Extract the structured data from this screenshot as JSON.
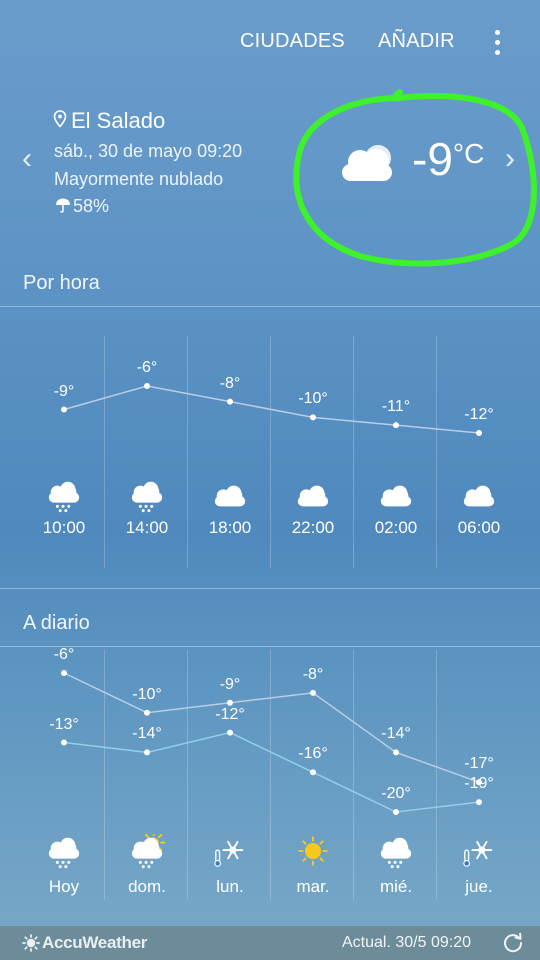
{
  "header": {
    "cities_label": "CIUDADES",
    "add_label": "AÑADIR"
  },
  "location": {
    "name": "El Salado",
    "datetime": "sáb., 30 de mayo 09:20",
    "condition": "Mayormente nublado",
    "precipitation": "58%"
  },
  "current": {
    "temperature": "-9",
    "unit": "°C",
    "icon": "cloud-icon"
  },
  "hourly": {
    "title": "Por hora",
    "items": [
      {
        "time": "10:00",
        "temp": "-9°",
        "value": -9,
        "icon": "cloud-snow-icon"
      },
      {
        "time": "14:00",
        "temp": "-6°",
        "value": -6,
        "icon": "cloud-snow-icon"
      },
      {
        "time": "18:00",
        "temp": "-8°",
        "value": -8,
        "icon": "cloud-icon"
      },
      {
        "time": "22:00",
        "temp": "-10°",
        "value": -10,
        "icon": "cloud-icon"
      },
      {
        "time": "02:00",
        "temp": "-11°",
        "value": -11,
        "icon": "cloud-icon"
      },
      {
        "time": "06:00",
        "temp": "-12°",
        "value": -12,
        "icon": "cloud-icon"
      }
    ]
  },
  "daily": {
    "title": "A diario",
    "items": [
      {
        "day": "Hoy",
        "high": "-6°",
        "low": "-13°",
        "high_value": -6,
        "low_value": -13,
        "icon": "cloud-snow-icon"
      },
      {
        "day": "dom.",
        "high": "-10°",
        "low": "-14°",
        "high_value": -10,
        "low_value": -14,
        "icon": "sun-cloud-snow-icon"
      },
      {
        "day": "lun.",
        "high": "-9°",
        "low": "-12°",
        "high_value": -9,
        "low_value": -12,
        "icon": "snowflake-cold-icon"
      },
      {
        "day": "mar.",
        "high": "-8°",
        "low": "-16°",
        "high_value": -8,
        "low_value": -16,
        "icon": "sun-icon"
      },
      {
        "day": "mié.",
        "high": "-14°",
        "low": "-20°",
        "high_value": -14,
        "low_value": -20,
        "icon": "cloud-snow-icon"
      },
      {
        "day": "jue.",
        "high": "-17°",
        "low": "-19°",
        "high_value": -17,
        "low_value": -19,
        "icon": "snowflake-cold-icon"
      }
    ]
  },
  "footer": {
    "brand": "AccuWeather",
    "updated": "Actual. 30/5  09:20"
  },
  "colors": {
    "annotation_green": "#3df22a",
    "high_line": "#b9cde3",
    "low_line": "#8fd0ea",
    "sun": "#f7c91f"
  }
}
